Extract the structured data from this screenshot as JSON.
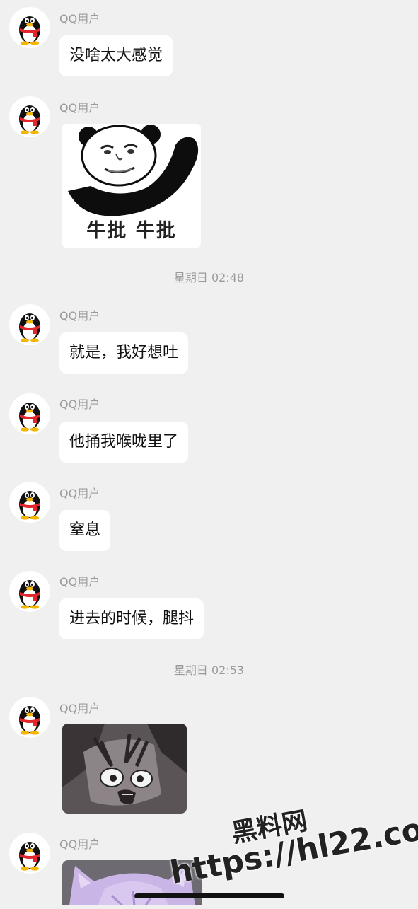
{
  "sender_name": "QQ用户",
  "messages": [
    {
      "type": "text",
      "text": "没啥太大感觉"
    },
    {
      "type": "sticker",
      "caption": "牛批  牛批"
    },
    {
      "type": "timestamp",
      "text": "星期日 02:48"
    },
    {
      "type": "text",
      "text": "就是，我好想吐"
    },
    {
      "type": "text",
      "text": "他捅我喉咙里了"
    },
    {
      "type": "text",
      "text": "窒息"
    },
    {
      "type": "text",
      "text": "进去的时候，腿抖"
    },
    {
      "type": "timestamp",
      "text": "星期日 02:53"
    },
    {
      "type": "image",
      "icon": "anime-scared-image"
    },
    {
      "type": "image",
      "icon": "anime-purple-hair-image"
    }
  ],
  "watermark": {
    "title": "黑料网",
    "url": "https://hl22.co"
  },
  "colors": {
    "background": "#f0f0f0",
    "bubble": "#ffffff",
    "meta_text": "#9a9a9a"
  }
}
